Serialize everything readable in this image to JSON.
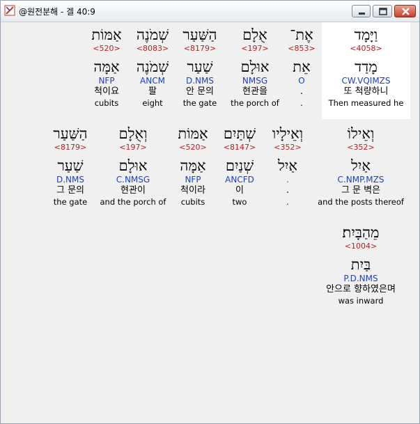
{
  "window": {
    "title": "@원전분해 - 겔 40:9"
  },
  "rows": [
    {
      "words": [
        {
          "surface": "וַיָּמָד",
          "strong": "<4058>",
          "lemma": "מָדַד",
          "morph": "CW.VQIMZS",
          "korean": "또 척량하니",
          "english": "Then measured he",
          "selected": true
        },
        {
          "surface": "אֶת־",
          "strong": "<853>",
          "lemma": "אֵת",
          "morph": "O",
          "korean": ".",
          "english": "."
        },
        {
          "surface": "אֻלָם",
          "strong": "<197>",
          "lemma": "אוּלָם",
          "morph": "NMSG",
          "korean": "현관을",
          "english": "the porch of"
        },
        {
          "surface": "הַשַּׁעַר",
          "strong": "<8179>",
          "lemma": "שַׁעַר",
          "morph": "D.NMS",
          "korean": "안 문의",
          "english": "the gate"
        },
        {
          "surface": "שְׁמֹנֶה",
          "strong": "<8083>",
          "lemma": "שְׁמֹנֶה",
          "morph": "ANCM",
          "korean": "팔",
          "english": "eight"
        },
        {
          "surface": "אַמּוֹת",
          "strong": "<520>",
          "lemma": "אַמָּה",
          "morph": "NFP",
          "korean": "척이요",
          "english": "cubits"
        }
      ]
    },
    {
      "words": [
        {
          "surface": "וְאֵילוֹ",
          "strong": "<352>",
          "lemma": "אַיִל",
          "morph": "C.NMP.MZS",
          "korean": "그 문 벽은",
          "english": "and the posts thereof"
        },
        {
          "surface": "וְאֵילָיו",
          "strong": "<352>",
          "lemma": "אַיִל",
          "morph": ".",
          "korean": ".",
          "english": "."
        },
        {
          "surface": "שְׁתַּיִם",
          "strong": "<8147>",
          "lemma": "שְׁנַיִם",
          "morph": "ANCFD",
          "korean": "이",
          "english": "two"
        },
        {
          "surface": "אַמּוֹת",
          "strong": "<520>",
          "lemma": "אַמָּה",
          "morph": "NFP",
          "korean": "척이라",
          "english": "cubits"
        },
        {
          "surface": "וְאֻלָם",
          "strong": "<197>",
          "lemma": "אוּלָם",
          "morph": "C.NMSG",
          "korean": "현관이",
          "english": "and the porch of"
        },
        {
          "surface": "הַשַּׁעַר",
          "strong": "<8179>",
          "lemma": "שַׁעַר",
          "morph": "D.NMS",
          "korean": "그 문의",
          "english": "the gate"
        }
      ]
    },
    {
      "words": [
        {
          "surface": "מֵהַבָּיִת׃",
          "strong": "<1004>",
          "lemma": "בַּיִת",
          "morph": "P.D.NMS",
          "korean": "안으로 향하였은며",
          "english": "was inward"
        }
      ]
    }
  ]
}
